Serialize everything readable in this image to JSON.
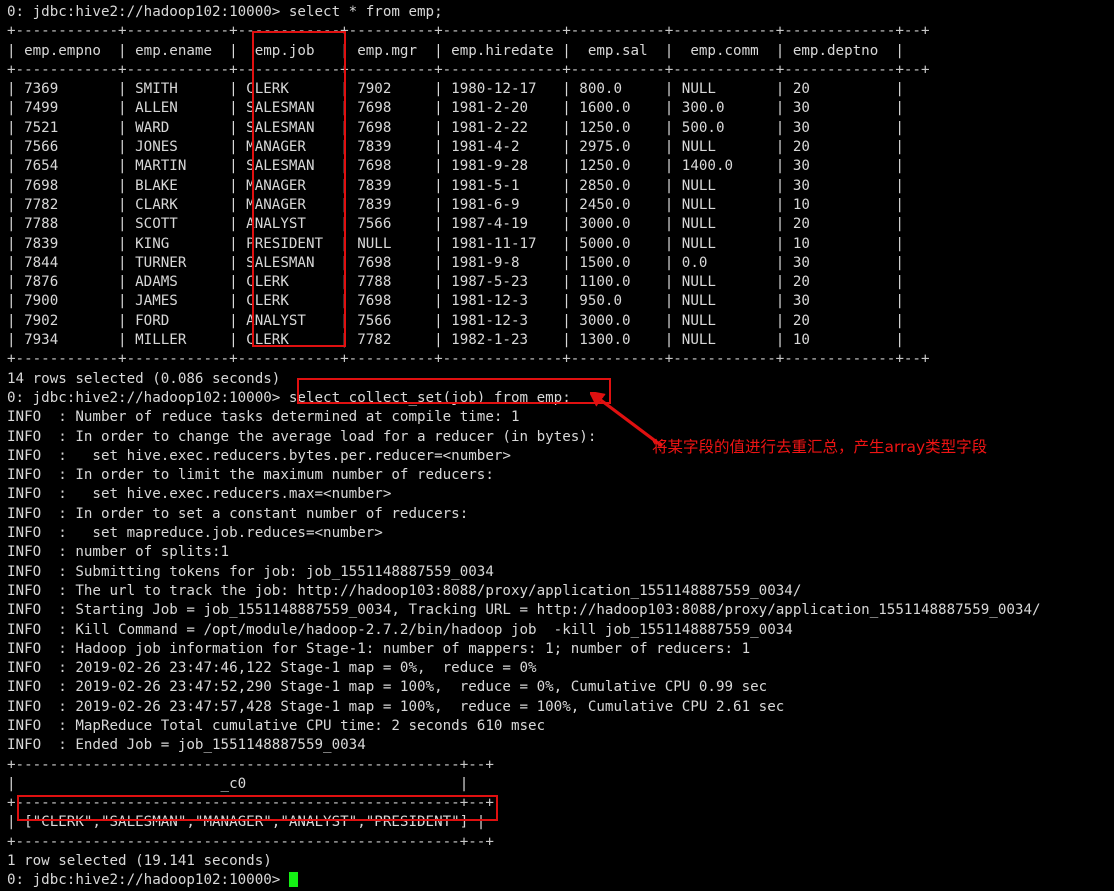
{
  "terminal": {
    "prompt": "0: jdbc:hive2://hadoop102:10000>",
    "colors": {
      "background": "#000000",
      "foreground": "#d8d8d8",
      "annotation_red": "#e01010",
      "cursor_green": "#14f014"
    },
    "lines": [
      "0: jdbc:hive2://hadoop102:10000> select * from emp;",
      "+------------+------------+------------+----------+--------------+-----------+------------+-------------+--+",
      "| emp.empno  | emp.ename  |  emp.job   | emp.mgr  | emp.hiredate |  emp.sal  |  emp.comm  | emp.deptno  |",
      "+------------+------------+------------+----------+--------------+-----------+------------+-------------+--+",
      "| 7369       | SMITH      | CLERK      | 7902     | 1980-12-17   | 800.0     | NULL       | 20          |",
      "| 7499       | ALLEN      | SALESMAN   | 7698     | 1981-2-20    | 1600.0    | 300.0      | 30          |",
      "| 7521       | WARD       | SALESMAN   | 7698     | 1981-2-22    | 1250.0    | 500.0      | 30          |",
      "| 7566       | JONES      | MANAGER    | 7839     | 1981-4-2     | 2975.0    | NULL       | 20          |",
      "| 7654       | MARTIN     | SALESMAN   | 7698     | 1981-9-28    | 1250.0    | 1400.0     | 30          |",
      "| 7698       | BLAKE      | MANAGER    | 7839     | 1981-5-1     | 2850.0    | NULL       | 30          |",
      "| 7782       | CLARK      | MANAGER    | 7839     | 1981-6-9     | 2450.0    | NULL       | 10          |",
      "| 7788       | SCOTT      | ANALYST    | 7566     | 1987-4-19    | 3000.0    | NULL       | 20          |",
      "| 7839       | KING       | PRESIDENT  | NULL     | 1981-11-17   | 5000.0    | NULL       | 10          |",
      "| 7844       | TURNER     | SALESMAN   | 7698     | 1981-9-8     | 1500.0    | 0.0        | 30          |",
      "| 7876       | ADAMS      | CLERK      | 7788     | 1987-5-23    | 1100.0    | NULL       | 20          |",
      "| 7900       | JAMES      | CLERK      | 7698     | 1981-12-3    | 950.0     | NULL       | 30          |",
      "| 7902       | FORD       | ANALYST    | 7566     | 1981-12-3    | 3000.0    | NULL       | 20          |",
      "| 7934       | MILLER     | CLERK      | 7782     | 1982-1-23    | 1300.0    | NULL       | 10          |",
      "+------------+------------+------------+----------+--------------+-----------+------------+-------------+--+",
      "14 rows selected (0.086 seconds)",
      "0: jdbc:hive2://hadoop102:10000> select collect_set(job) from emp;",
      "INFO  : Number of reduce tasks determined at compile time: 1",
      "INFO  : In order to change the average load for a reducer (in bytes):",
      "INFO  :   set hive.exec.reducers.bytes.per.reducer=<number>",
      "INFO  : In order to limit the maximum number of reducers:",
      "INFO  :   set hive.exec.reducers.max=<number>",
      "INFO  : In order to set a constant number of reducers:",
      "INFO  :   set mapreduce.job.reduces=<number>",
      "INFO  : number of splits:1",
      "INFO  : Submitting tokens for job: job_1551148887559_0034",
      "INFO  : The url to track the job: http://hadoop103:8088/proxy/application_1551148887559_0034/",
      "INFO  : Starting Job = job_1551148887559_0034, Tracking URL = http://hadoop103:8088/proxy/application_1551148887559_0034/",
      "INFO  : Kill Command = /opt/module/hadoop-2.7.2/bin/hadoop job  -kill job_1551148887559_0034",
      "INFO  : Hadoop job information for Stage-1: number of mappers: 1; number of reducers: 1",
      "INFO  : 2019-02-26 23:47:46,122 Stage-1 map = 0%,  reduce = 0%",
      "INFO  : 2019-02-26 23:47:52,290 Stage-1 map = 100%,  reduce = 0%, Cumulative CPU 0.99 sec",
      "INFO  : 2019-02-26 23:47:57,428 Stage-1 map = 100%,  reduce = 100%, Cumulative CPU 2.61 sec",
      "INFO  : MapReduce Total cumulative CPU time: 2 seconds 610 msec",
      "INFO  : Ended Job = job_1551148887559_0034",
      "+----------------------------------------------------+--+",
      "|                        _c0                         |",
      "+----------------------------------------------------+--+",
      "| [\"CLERK\",\"SALESMAN\",\"MANAGER\",\"ANALYST\",\"PRESIDENT\"] |",
      "+----------------------------------------------------+--+",
      "1 row selected (19.141 seconds)"
    ],
    "final_prompt": "0: jdbc:hive2://hadoop102:10000> "
  },
  "query_1": {
    "command": "select * from emp;",
    "result_count": "14 rows selected (0.086 seconds)"
  },
  "query_2": {
    "command": "select collect_set(job) from emp;",
    "result_count": "1 row selected (19.141 seconds)",
    "result_value": "[\"CLERK\",\"SALESMAN\",\"MANAGER\",\"ANALYST\",\"PRESIDENT\"]",
    "result_column": "_c0"
  },
  "emp_table": {
    "headers": [
      "emp.empno",
      "emp.ename",
      "emp.job",
      "emp.mgr",
      "emp.hiredate",
      "emp.sal",
      "emp.comm",
      "emp.deptno"
    ],
    "rows": [
      [
        "7369",
        "SMITH",
        "CLERK",
        "7902",
        "1980-12-17",
        "800.0",
        "NULL",
        "20"
      ],
      [
        "7499",
        "ALLEN",
        "SALESMAN",
        "7698",
        "1981-2-20",
        "1600.0",
        "300.0",
        "30"
      ],
      [
        "7521",
        "WARD",
        "SALESMAN",
        "7698",
        "1981-2-22",
        "1250.0",
        "500.0",
        "30"
      ],
      [
        "7566",
        "JONES",
        "MANAGER",
        "7839",
        "1981-4-2",
        "2975.0",
        "NULL",
        "20"
      ],
      [
        "7654",
        "MARTIN",
        "SALESMAN",
        "7698",
        "1981-9-28",
        "1250.0",
        "1400.0",
        "30"
      ],
      [
        "7698",
        "BLAKE",
        "MANAGER",
        "7839",
        "1981-5-1",
        "2850.0",
        "NULL",
        "30"
      ],
      [
        "7782",
        "CLARK",
        "MANAGER",
        "7839",
        "1981-6-9",
        "2450.0",
        "NULL",
        "10"
      ],
      [
        "7788",
        "SCOTT",
        "ANALYST",
        "7566",
        "1987-4-19",
        "3000.0",
        "NULL",
        "20"
      ],
      [
        "7839",
        "KING",
        "PRESIDENT",
        "NULL",
        "1981-11-17",
        "5000.0",
        "NULL",
        "10"
      ],
      [
        "7844",
        "TURNER",
        "SALESMAN",
        "7698",
        "1981-9-8",
        "1500.0",
        "0.0",
        "30"
      ],
      [
        "7876",
        "ADAMS",
        "CLERK",
        "7788",
        "1987-5-23",
        "1100.0",
        "NULL",
        "20"
      ],
      [
        "7900",
        "JAMES",
        "CLERK",
        "7698",
        "1981-12-3",
        "950.0",
        "NULL",
        "30"
      ],
      [
        "7902",
        "FORD",
        "ANALYST",
        "7566",
        "1981-12-3",
        "3000.0",
        "NULL",
        "20"
      ],
      [
        "7934",
        "MILLER",
        "CLERK",
        "7782",
        "1982-1-23",
        "1300.0",
        "NULL",
        "10"
      ]
    ]
  },
  "annotation": {
    "chinese_note": "将某字段的值进行去重汇总，产生array类型字段"
  }
}
